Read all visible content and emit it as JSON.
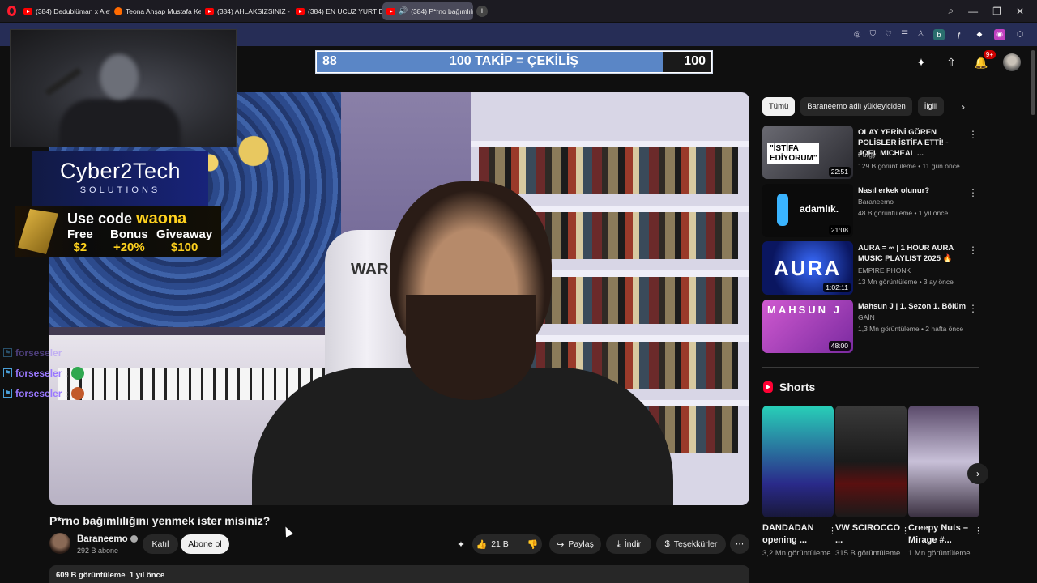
{
  "browser": {
    "tabs": [
      {
        "title": "(384) Dedublüman x Aley"
      },
      {
        "title": "Teona Ahşap Mustafa Ken"
      },
      {
        "title": "(384) AHLAKSIZSINIZ - Lu"
      },
      {
        "title": "(384) EN UCUZ YURT DIŞI"
      },
      {
        "title": "(384) P*rno bağımlılığ"
      }
    ],
    "new_tab": "+"
  },
  "overlay": {
    "goal_current": "88",
    "goal_text": "100 TAKİP = ÇEKİLİŞ",
    "goal_max": "100",
    "goal_progress": 0.88,
    "sponsor_brand": "Cyber2Tech",
    "sponsor_sub": "SOLUTIONS",
    "promo_use": "Use code",
    "promo_code": "waona",
    "promo_cols": [
      {
        "label": "Free",
        "value": "$2"
      },
      {
        "label": "Bonus",
        "value": "+20%"
      },
      {
        "label": "Giveaway",
        "value": "$100"
      }
    ],
    "chat": [
      {
        "user": "forseseler"
      },
      {
        "user": "forseseler",
        "sep": ":"
      },
      {
        "user": "forseseler",
        "sep": ":"
      }
    ]
  },
  "youtube": {
    "notif_count": "9+",
    "video": {
      "title": "P*rno bağımlılığını yenmek ister misiniz?",
      "channel": "Baraneemo",
      "subscribers": "292 B abone",
      "join_label": "Katıl",
      "subscribe_label": "Abone ol",
      "likes": "21 B",
      "share_label": "Paylaş",
      "download_label": "İndir",
      "thanks_label": "Teşekkürler",
      "views": "609 B görüntüleme",
      "age": "1 yıl önce",
      "chair_text": "WAR"
    },
    "chips": [
      "Tümü",
      "Baraneemo adlı yükleyiciden",
      "İlgili"
    ],
    "recommendations": [
      {
        "title": "OLAY YERİNİ GÖREN POLİSLER İSTİFA ETTİ! - JOEL MICHEAL ...",
        "channel": "Purgy",
        "meta": "129 B görüntüleme • 11 gün önce",
        "duration": "22:51",
        "thumb_text": "\"İSTİFA EDİYORUM\""
      },
      {
        "title": "Nasıl erkek olunur?",
        "channel": "Baraneemo",
        "meta": "48 B görüntüleme • 1 yıl önce",
        "duration": "21:08",
        "thumb_text": "adamlık."
      },
      {
        "title": "AURA = ∞ | 1 HOUR AURA MUSIC PLAYLIST 2025 🔥",
        "channel": "EMPIRE PHONK",
        "meta": "13 Mn görüntüleme • 3 ay önce",
        "duration": "1:02:11",
        "thumb_text": "AURA"
      },
      {
        "title": "Mahsun J | 1. Sezon 1. Bölüm",
        "channel": "GAİN",
        "meta": "1,3 Mn görüntüleme • 2 hafta önce",
        "duration": "48:00",
        "thumb_text": "MAHSUN J"
      }
    ],
    "shorts_label": "Shorts",
    "shorts": [
      {
        "title": "DANDADAN opening ...",
        "views": "3,2 Mn görüntüleme"
      },
      {
        "title": "VW SCIROCCO ...",
        "views": "315 B görüntüleme"
      },
      {
        "title": "Creepy Nuts – Mirage #...",
        "views": "1 Mn görüntüleme"
      }
    ]
  },
  "colors": {
    "background": "#0f0f0f",
    "address_bar": "#262d56",
    "banner_fill": "#5a86c6",
    "subscribe_bg": "#f1f1f1",
    "youtube_red": "#ff0000"
  }
}
